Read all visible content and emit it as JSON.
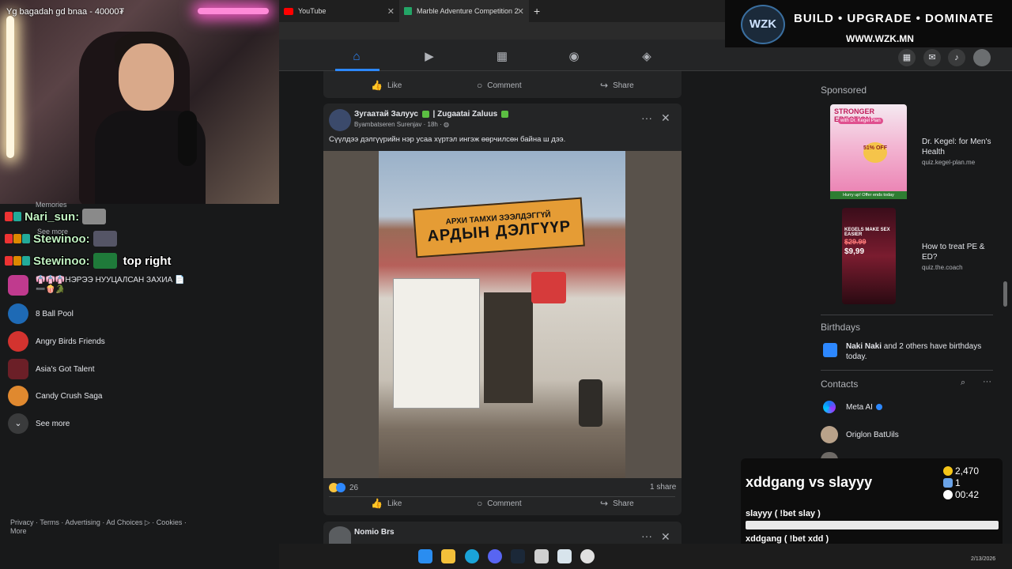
{
  "browser": {
    "tabs": [
      {
        "title": "YouTube"
      },
      {
        "title": "Marble Adventure Competition 20"
      }
    ],
    "new_tab": "+"
  },
  "stream": {
    "caption": "Yg bagadah gd bnaa - 40000₮",
    "chat": [
      {
        "user": "Nari_sun:",
        "message": ""
      },
      {
        "user": "Stewinoo:",
        "message": ""
      },
      {
        "user": "Stewinoo:",
        "message": "top right"
      }
    ]
  },
  "sidebar": {
    "partial_items": [
      "Memories",
      "See more"
    ],
    "items": [
      {
        "label": "👘👘👘НЭРЭЭ НУУЦАЛСАН ЗАХИА 📄",
        "label2": "➖🍿🐊",
        "color": "#c03a8e"
      },
      {
        "label": "8 Ball Pool",
        "color": "#1e6ab5"
      },
      {
        "label": "Angry Birds Friends",
        "color": "#d3332f"
      },
      {
        "label": "Asia's Got Talent",
        "color": "#6b1f27"
      },
      {
        "label": "Candy Crush Saga",
        "color": "#e0892f"
      }
    ],
    "see_more": "See more",
    "footer": "Privacy · Terms · Advertising · Ad Choices ▷ · Cookies · More"
  },
  "feed": {
    "top_actions": {
      "like": "Like",
      "comment": "Comment",
      "share": "Share"
    },
    "post": {
      "author": "Зугаатай Залуус",
      "page": "| Zugaatai Zaluus",
      "sub_author": "Byambatseren Surenjav",
      "time": "18h",
      "text": "Сүүлдээ дэлгүүрийн нэр усаа хүртэл ингэж өөрчилсөн байна ш дээ.",
      "image_sign_line1": "АРХИ ТАМХИ ЗЭЭЛДЭГГҮЙ",
      "image_sign_line2": "АРДЫН ДЭЛГҮҮР",
      "reactions_count": "26",
      "shares": "1 share",
      "actions": {
        "like": "Like",
        "comment": "Comment",
        "share": "Share"
      }
    },
    "next_post_author": "Nomio Brs"
  },
  "right": {
    "sponsored_heading": "Sponsored",
    "ads": [
      {
        "image_text": "STRONGER ERECTION",
        "image_sub": "with Dr. Kegel Plan",
        "badge": "51% OFF",
        "footer": "Hurry up! Offer ends today",
        "title": "Dr. Kegel: for Men's Health",
        "url": "quiz.kegel-plan.me"
      },
      {
        "image_text": "KEGELS MAKE SEX EASIER",
        "price_old": "$29.99",
        "price_new": "$9,99",
        "title": "How to treat PE & ED?",
        "url": "quiz.the.coach"
      }
    ],
    "birthdays_heading": "Birthdays",
    "birthday_name": "Naki Naki",
    "birthday_text": " and 2 others have birthdays today.",
    "contacts_heading": "Contacts",
    "contacts": [
      {
        "name": "Meta AI"
      },
      {
        "name": "Origlon BatUils"
      }
    ]
  },
  "banner": {
    "logo": "WZK",
    "tagline": "BUILD • UPGRADE • DOMINATE",
    "url": "WWW.WZK.MN"
  },
  "prediction": {
    "title": "xddgang vs slayyy",
    "points": "2,470",
    "users": "1",
    "timer": "00:42",
    "options": [
      {
        "label": "slayyy ( !bet slay )",
        "fraction": 0.0,
        "color": "#e9e9e9"
      },
      {
        "label": "xddgang ( !bet xdd )",
        "fraction": 1.0,
        "color": "#35c25a"
      }
    ]
  },
  "taskbar": {
    "date": "2/13/2026"
  }
}
